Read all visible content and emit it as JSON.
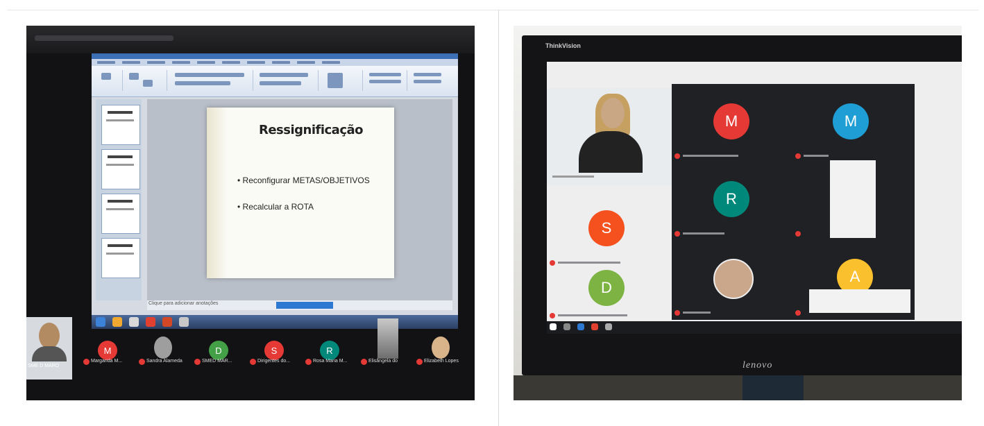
{
  "left": {
    "slide": {
      "title": "Ressignificação",
      "bullets": [
        "Reconfigurar  METAS/OBJETIVOS",
        "Recalcular a ROTA"
      ]
    },
    "notes_label": "Clique para adicionar anotações",
    "participants": [
      {
        "initial": "",
        "name": "SME D MARO",
        "color": "",
        "photo": true
      },
      {
        "initial": "M",
        "name": "Margarida M...",
        "color": "#e53935",
        "photo": false
      },
      {
        "initial": "",
        "name": "Sandra Alameda",
        "color": "",
        "photo": true
      },
      {
        "initial": "D",
        "name": "SMED MAR...",
        "color": "#43a047",
        "photo": false
      },
      {
        "initial": "S",
        "name": "Dirigentes do...",
        "color": "#e53935",
        "photo": false
      },
      {
        "initial": "R",
        "name": "Rosa Maria M...",
        "color": "#00897b",
        "photo": false
      },
      {
        "initial": "",
        "name": "Elisângela do",
        "color": "",
        "photo": true
      },
      {
        "initial": "",
        "name": "Elizabeth Lopes",
        "color": "",
        "photo": true
      }
    ]
  },
  "right": {
    "brand_top": "ThinkVision",
    "brand_bottom": "lenovo",
    "participants": [
      {
        "initial": "M",
        "color": "#e53935"
      },
      {
        "initial": "M",
        "color": "#1e9ed4"
      },
      {
        "initial": "S",
        "color": "#f4511e"
      },
      {
        "initial": "R",
        "color": "#00897b"
      },
      {
        "initial": "D",
        "color": "#7cb342"
      },
      {
        "initial": "A",
        "color": "#fbc02d"
      }
    ]
  },
  "colors": {
    "meet_bg": "#202124",
    "mic_off": "#e53935"
  }
}
